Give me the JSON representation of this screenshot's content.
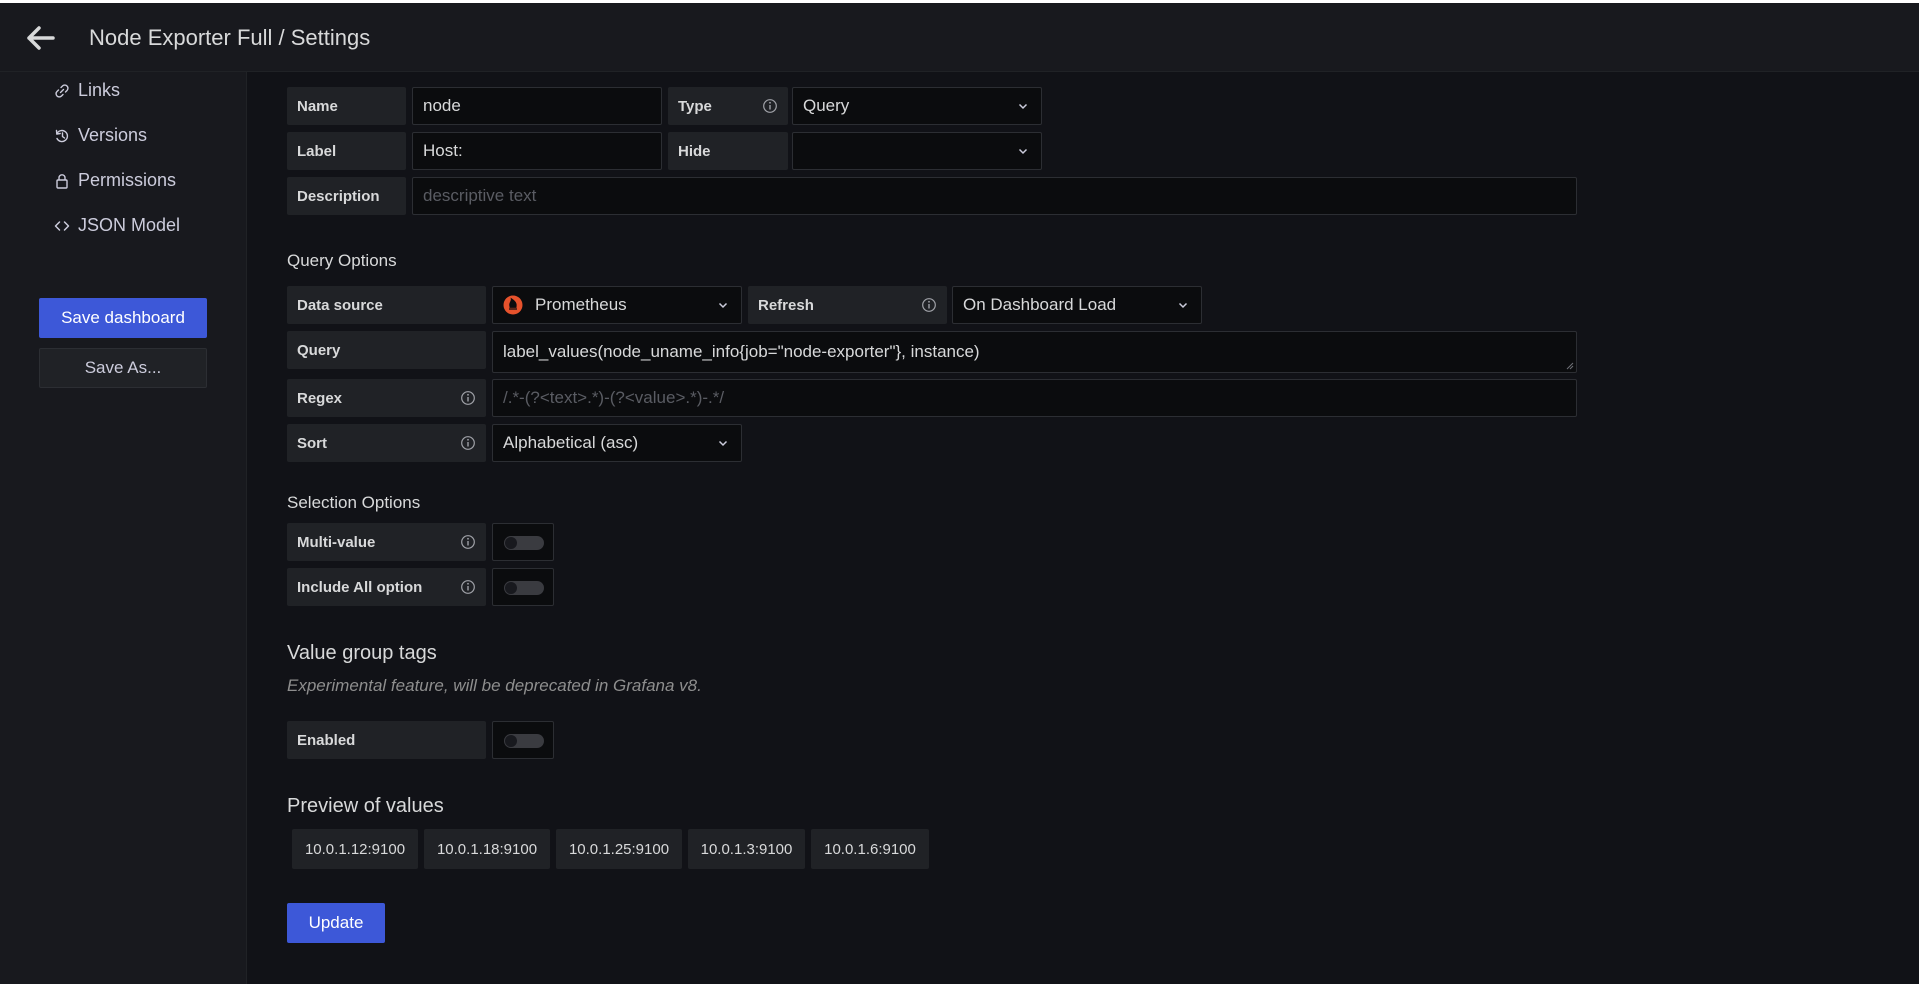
{
  "header": {
    "title": "Node Exporter Full / Settings"
  },
  "sidebar": {
    "items": [
      {
        "label": "Links",
        "icon": "link-icon"
      },
      {
        "label": "Versions",
        "icon": "history-icon"
      },
      {
        "label": "Permissions",
        "icon": "lock-icon"
      },
      {
        "label": "JSON Model",
        "icon": "code-icon"
      }
    ],
    "save_label": "Save dashboard",
    "save_as_label": "Save As..."
  },
  "general": {
    "name_label": "Name",
    "name_value": "node",
    "type_label": "Type",
    "type_value": "Query",
    "label_label": "Label",
    "label_value": "Host:",
    "hide_label": "Hide",
    "hide_value": "",
    "description_label": "Description",
    "description_placeholder": "descriptive text"
  },
  "query_options": {
    "title": "Query Options",
    "datasource_label": "Data source",
    "datasource_value": "Prometheus",
    "refresh_label": "Refresh",
    "refresh_value": "On Dashboard Load",
    "query_label": "Query",
    "query_value": "label_values(node_uname_info{job=\"node-exporter\"}, instance)",
    "regex_label": "Regex",
    "regex_placeholder": "/.*-(?<text>.*)-(?<value>.*)-.*/",
    "sort_label": "Sort",
    "sort_value": "Alphabetical (asc)"
  },
  "selection_options": {
    "title": "Selection Options",
    "multi_label": "Multi-value",
    "include_all_label": "Include All option"
  },
  "value_group_tags": {
    "title": "Value group tags",
    "note": "Experimental feature, will be deprecated in Grafana v8.",
    "enabled_label": "Enabled"
  },
  "preview": {
    "title": "Preview of values",
    "values": [
      "10.0.1.12:9100",
      "10.0.1.18:9100",
      "10.0.1.25:9100",
      "10.0.1.3:9100",
      "10.0.1.6:9100"
    ]
  },
  "update_label": "Update",
  "colors": {
    "primary": "#3d58d8",
    "prometheus": "#e6522c"
  }
}
